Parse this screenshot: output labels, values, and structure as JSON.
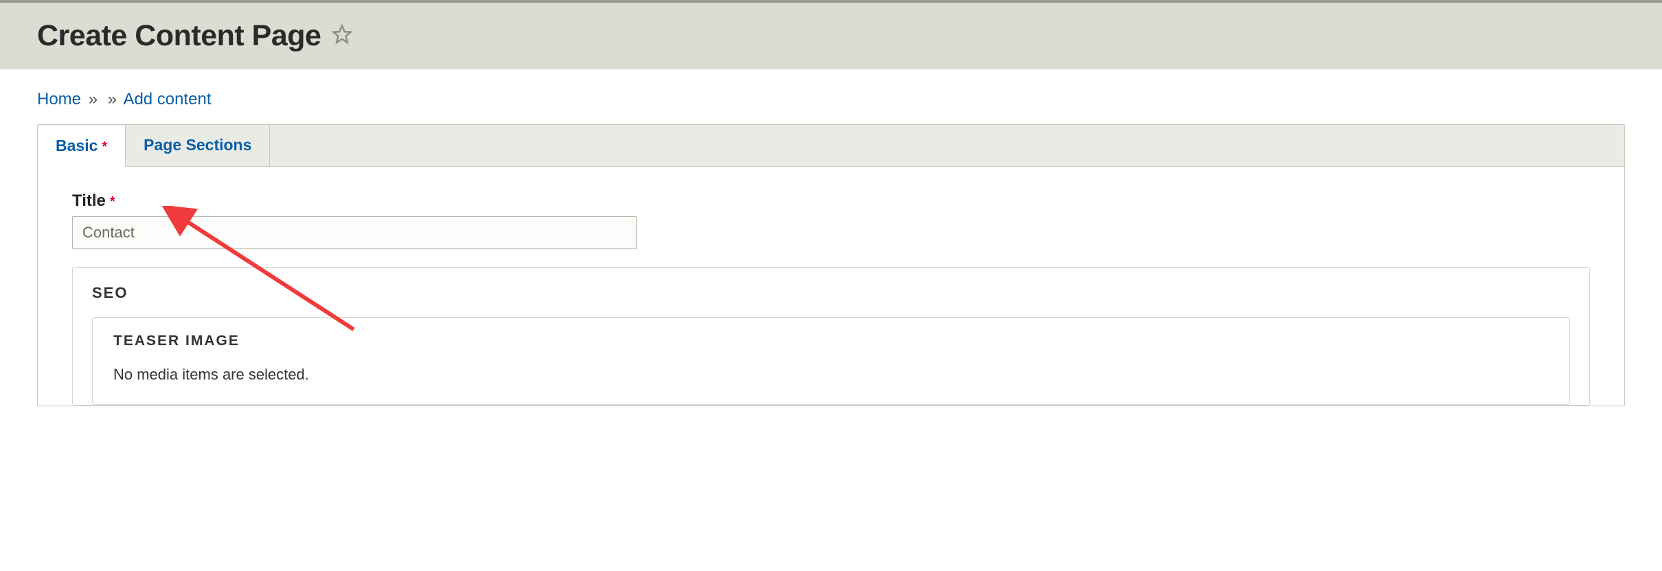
{
  "header": {
    "title": "Create Content Page"
  },
  "breadcrumb": {
    "home_label": "Home",
    "add_content_label": "Add content",
    "separator": "»"
  },
  "tabs": {
    "basic_label": "Basic",
    "page_sections_label": "Page Sections",
    "required_marker": "*"
  },
  "form": {
    "title_label": "Title",
    "title_value": "Contact",
    "required_marker": "*"
  },
  "seo": {
    "section_label": "SEO",
    "teaser_image_label": "TEASER IMAGE",
    "media_empty_text": "No media items are selected."
  }
}
